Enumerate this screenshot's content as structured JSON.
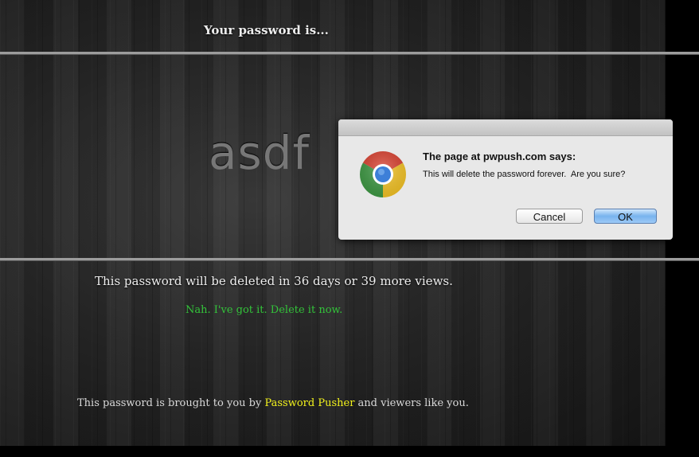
{
  "page": {
    "heading": "Your password is...",
    "password": "asdf",
    "expiry_text": "This password will be deleted in 36 days or 39 more views.",
    "delete_link": "Nah. I've got it. Delete it now.",
    "footer": {
      "prefix": "This password is brought to you by ",
      "brand": "Password Pusher",
      "suffix": " and viewers like you."
    },
    "colors": {
      "link_green": "#33c33a",
      "brand_yellow": "#f2f21c"
    }
  },
  "dialog": {
    "icon": "chrome-logo-icon",
    "title": "The page at pwpush.com says:",
    "message": "This will delete the password forever.  Are you sure?",
    "cancel_label": "Cancel",
    "ok_label": "OK"
  }
}
